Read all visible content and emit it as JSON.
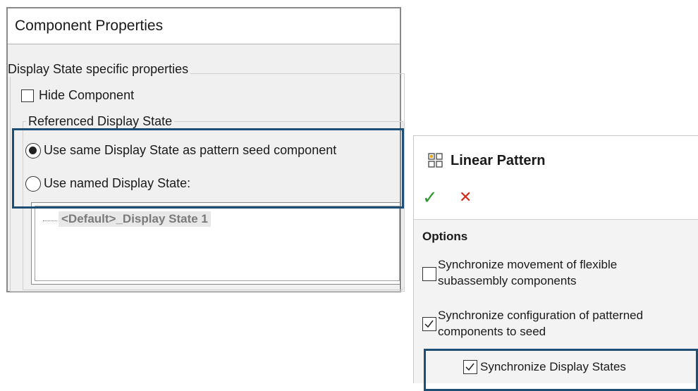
{
  "component_properties": {
    "title": "Component Properties",
    "group_title": "Display State specific properties",
    "hide_component": {
      "label": "Hide Component",
      "checked": false
    },
    "referenced_group_title": "Referenced Display State",
    "options": [
      {
        "label": "Use same Display State as pattern seed component",
        "selected": true
      },
      {
        "label": "Use named Display State:",
        "selected": false
      }
    ],
    "display_states": [
      "<Default>_Display State 1"
    ]
  },
  "linear_pattern": {
    "title": "Linear Pattern",
    "icon": "linear-pattern-icon",
    "ok_icon": "✓",
    "cancel_icon": "✕",
    "options_title": "Options",
    "sync_movement": {
      "label_line1": "Synchronize movement of flexible",
      "label_line2": "subassembly components",
      "checked": false
    },
    "sync_config": {
      "label_line1": "Synchronize configuration of patterned",
      "label_line2": "components to seed",
      "checked": true
    },
    "sync_display": {
      "label": "Synchronize Display States",
      "checked": true
    }
  },
  "colors": {
    "highlight": "#1f4e74",
    "ok": "#2e9a2e",
    "cancel": "#d42a1c"
  }
}
